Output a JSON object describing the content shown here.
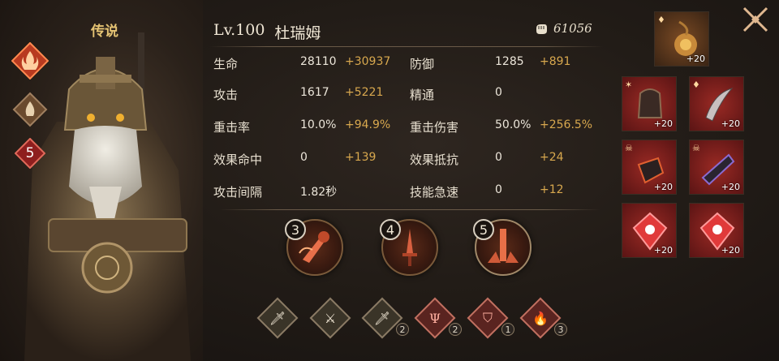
{
  "hero": {
    "rarity": "传说",
    "level_label": "Lv.100",
    "name": "杜瑞姆",
    "stars_badge": "5",
    "power": "61056"
  },
  "stats": {
    "rows": [
      {
        "l1": "生命",
        "v1": "28110",
        "b1": "+30937",
        "l2": "防御",
        "v2": "1285",
        "b2": "+891"
      },
      {
        "l1": "攻击",
        "v1": "1617",
        "b1": "+5221",
        "l2": "精通",
        "v2": "0",
        "b2": ""
      },
      {
        "l1": "重击率",
        "v1": "10.0%",
        "b1": "+94.9%",
        "l2": "重击伤害",
        "v2": "50.0%",
        "b2": "+256.5%"
      },
      {
        "l1": "效果命中",
        "v1": "0",
        "b1": "+139",
        "l2": "效果抵抗",
        "v2": "0",
        "b2": "+24"
      },
      {
        "l1": "攻击间隔",
        "v1": "1.82秒",
        "b1": "",
        "l2": "技能急速",
        "v2": "0",
        "b2": "+12"
      }
    ]
  },
  "skills": [
    {
      "num": "3",
      "icon": "axe-swing-icon"
    },
    {
      "num": "4",
      "icon": "sword-strike-icon"
    },
    {
      "num": "5",
      "icon": "pillar-burst-icon"
    }
  ],
  "runes": [
    {
      "icon": "sword-icon",
      "count": "",
      "color": "#3a3428"
    },
    {
      "icon": "sword-ground-icon",
      "count": "",
      "color": "#3a3428"
    },
    {
      "icon": "sword-icon",
      "count": "2",
      "color": "#3a3428"
    },
    {
      "icon": "trident-icon",
      "count": "2",
      "color": "#5a2420"
    },
    {
      "icon": "shield-icon",
      "count": "1",
      "color": "#5a2420"
    },
    {
      "icon": "flame-icon",
      "count": "3",
      "color": "#5a2420"
    }
  ],
  "equipment": [
    {
      "name": "artifact-slot",
      "plus": "+20",
      "bg": "#4a2a1a"
    },
    {
      "name": "armor-slot",
      "plus": "+20",
      "bg": "#6a1a1a"
    },
    {
      "name": "blade-slot",
      "plus": "+20",
      "bg": "#6a1a1a"
    },
    {
      "name": "gauntlet-slot",
      "plus": "+20",
      "bg": "#6a1a1a"
    },
    {
      "name": "bracer-slot",
      "plus": "+20",
      "bg": "#6a1a1a"
    },
    {
      "name": "gem-slot-1",
      "plus": "+20",
      "bg": "#6a1a1a"
    },
    {
      "name": "gem-slot-2",
      "plus": "+20",
      "bg": "#6a1a1a"
    }
  ]
}
